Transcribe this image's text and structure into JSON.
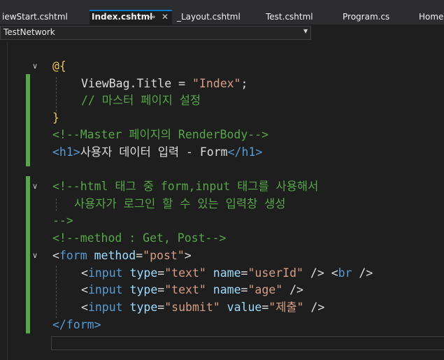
{
  "tabs": [
    {
      "label": "iewStart.cshtml"
    },
    {
      "label": "Index.cshtml",
      "pin": "⊸",
      "close": "✕"
    },
    {
      "label": "_Layout.cshtml"
    },
    {
      "label": "Test.cshtml"
    },
    {
      "label": "Program.cs"
    },
    {
      "label": "HomeC"
    }
  ],
  "navbar": {
    "project": "TestNetwork"
  },
  "code": {
    "l1_open": "@{",
    "l2_a": "ViewBag.Title = ",
    "l2_b": "\"Index\"",
    "l2_c": ";",
    "l3": "// 마스터 페이지 설정",
    "l4": "}",
    "l5": "<!--Master 페이지의 RenderBody-->",
    "l6_open": "<h1>",
    "l6_text": "사용자 데이터 입력 - Form",
    "l6_close": "</h1>",
    "l8": "<!--html 태그 중 form,input 태그를 사용해서",
    "l9": "사용자가 로그인 할 수 있는 입력창 생성",
    "l10": "-->",
    "l11": "<!--method : Get, Post-->",
    "l12_a": "<",
    "l12_tag": "form",
    "l12_attr": " method",
    "l12_eq": "=",
    "l12_val": "\"post\"",
    "l12_end": ">",
    "l13": {
      "tag": "input",
      "a1": "type",
      "v1": "\"text\"",
      "a2": "name",
      "v2": "\"userId\"",
      "tail": " /> <",
      "br": "br",
      "tail2": " />"
    },
    "l14": {
      "tag": "input",
      "a1": "type",
      "v1": "\"text\"",
      "a2": "name",
      "v2": "\"age\"",
      "tail": " />"
    },
    "l15": {
      "tag": "input",
      "a1": "type",
      "v1": "\"submit\"",
      "a2": "value",
      "v2": "\"제출\"",
      "tail": " />"
    },
    "l16": "</form>"
  }
}
